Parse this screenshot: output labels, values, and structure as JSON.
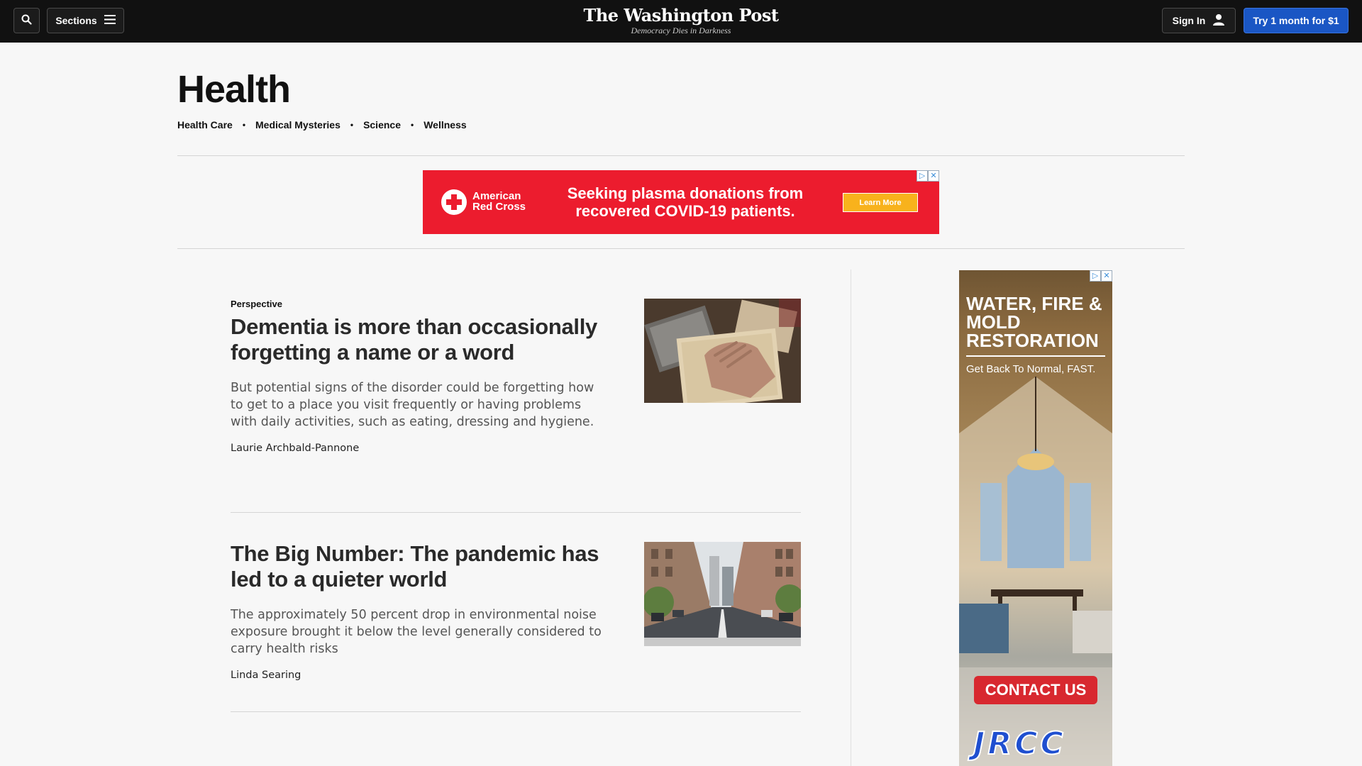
{
  "header": {
    "sections_label": "Sections",
    "logo_text": "The Washington Post",
    "tagline": "Democracy Dies in Darkness",
    "signin_label": "Sign In",
    "subscribe_label": "Try 1 month for $1",
    "icons": [
      "search-icon",
      "menu-icon",
      "user-icon"
    ]
  },
  "section": {
    "title": "Health",
    "nav": [
      "Health Care",
      "Medical Mysteries",
      "Science",
      "Wellness"
    ]
  },
  "ad_top": {
    "brand_line1": "American",
    "brand_line2": "Red Cross",
    "headline": "Seeking plasma donations from recovered COVID-19 patients.",
    "cta": "Learn More",
    "bg_color": "#ec1c2e"
  },
  "articles": [
    {
      "kicker": "Perspective",
      "title": "Dementia is more than occasionally forgetting a name or a word",
      "blurb": "But potential signs of the disorder could be forgetting how to get to a place you visit frequently or having problems with daily activities, such as eating, dressing and hygiene.",
      "byline": "Laurie Archbald-Pannone"
    },
    {
      "kicker": "",
      "title": "The Big Number: The pandemic has led to a quieter world",
      "blurb": "The approximately 50 percent drop in environmental noise exposure brought it below the level generally considered to carry health risks",
      "byline": "Linda Searing"
    }
  ],
  "ad_side": {
    "headline": "WATER, FIRE & MOLD RESTORATION",
    "subline": "Get Back To Normal, FAST.",
    "cta": "CONTACT US",
    "logo": "JRCC"
  }
}
